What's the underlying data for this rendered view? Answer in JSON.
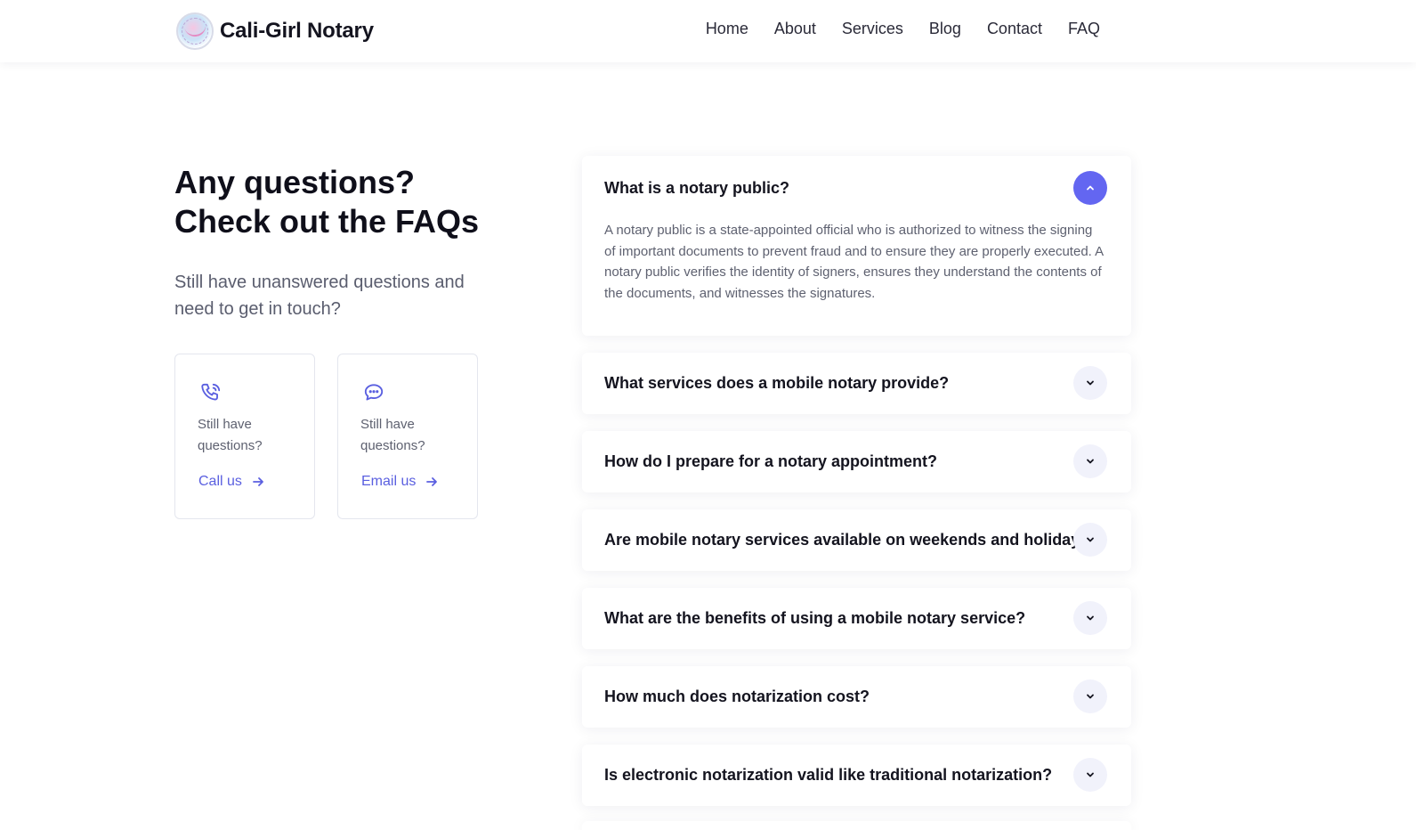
{
  "nav": {
    "brand": "Cali-Girl Notary",
    "items": [
      "Home",
      "About",
      "Services",
      "Blog",
      "Contact",
      "FAQ"
    ]
  },
  "hero": {
    "heading_line1": "Any questions?",
    "heading_line2": "Check out the FAQs",
    "subtitle": "Still have unanswered questions and need to get in touch?"
  },
  "contact_cards": [
    {
      "text": "Still have questions?",
      "action": "Call us",
      "icon": "phone-icon"
    },
    {
      "text": "Still have questions?",
      "action": "Email us",
      "icon": "chat-bubble-icon"
    }
  ],
  "faqs": [
    {
      "question": "What is a notary public?",
      "expanded": true,
      "answer": "A notary public is a state-appointed official who is authorized to witness the signing of important documents to prevent fraud and to ensure they are properly executed. A notary public verifies the identity of signers, ensures they understand the contents of the documents, and witnesses the signatures."
    },
    {
      "question": "What services does a mobile notary provide?",
      "expanded": false
    },
    {
      "question": "How do I prepare for a notary appointment?",
      "expanded": false
    },
    {
      "question": "Are mobile notary services available on weekends and holidays?",
      "expanded": false
    },
    {
      "question": "What are the benefits of using a mobile notary service?",
      "expanded": false
    },
    {
      "question": "How much does notarization cost?",
      "expanded": false
    },
    {
      "question": "Is electronic notarization valid like traditional notarization?",
      "expanded": false
    }
  ],
  "colors": {
    "accent": "#6366f1",
    "link": "#5a5fe0",
    "heading": "#0f0f1a",
    "muted": "#5e6170"
  }
}
